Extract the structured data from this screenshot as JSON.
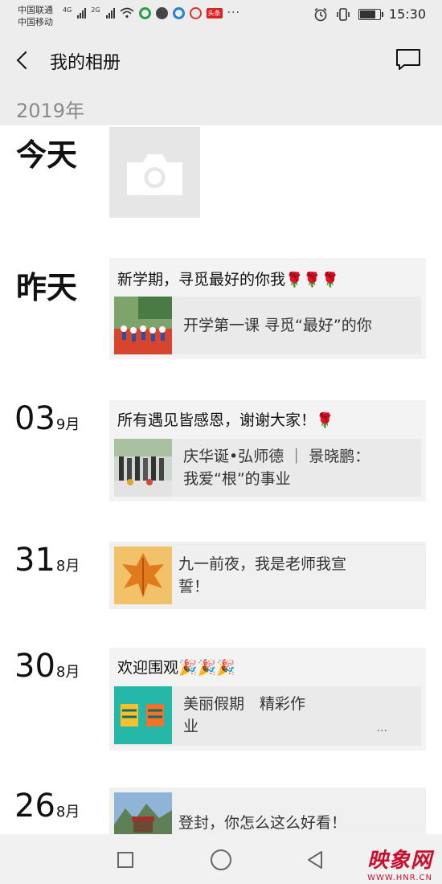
{
  "status": {
    "carrier1": "中国联通",
    "net1": "4G",
    "carrier2": "中国移动",
    "net2": "2G",
    "toutiao": "头条",
    "more": "···",
    "time": "15:30",
    "battery_level": 0.8
  },
  "nav": {
    "title": "我的相册"
  },
  "year_header": "2019年",
  "entries": [
    {
      "date": "今天"
    },
    {
      "date": "昨天",
      "text": "新学期，寻觅最好的你我",
      "emoji": "🌹🌹🌹",
      "link": "开学第一课 寻觅“最好”的你"
    },
    {
      "day": "03",
      "month": "9月",
      "text": "所有遇见皆感恩，谢谢大家！",
      "emoji": "🌹",
      "link_line1": "庆华诞•弘师德 ｜ 景晓鹏：",
      "link_line2": "我爱“根”的事业"
    },
    {
      "day": "31",
      "month": "8月",
      "link_line1": "九一前夜，我是老师我宣",
      "link_line2": "誓！"
    },
    {
      "day": "30",
      "month": "8月",
      "text": "欢迎围观",
      "emoji": "🎉🎉🎉",
      "link_line1": "美丽假期　精彩作",
      "link_line2": "业",
      "ellipsis": "..."
    },
    {
      "day": "26",
      "month": "8月",
      "link": "登封，你怎么这么好看！"
    }
  ],
  "watermark": {
    "main": "映象网",
    "sub": "WWW.HNR.CN"
  },
  "colors": {
    "header_bg": "#ededed",
    "card_bg": "#f3f3f3",
    "link_bg": "#eaeaea",
    "accent_red": "#c8102e"
  }
}
